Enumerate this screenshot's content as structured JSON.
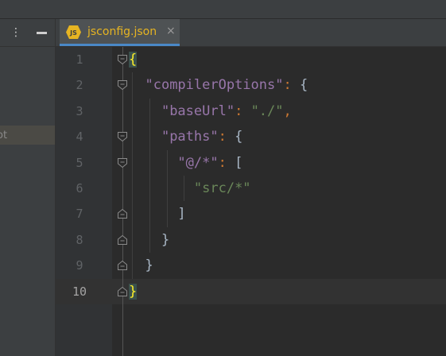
{
  "left_panel": {
    "tree_item_label": "ot"
  },
  "tabs": [
    {
      "label": "jsconfig.json",
      "icon": "js-file-icon",
      "icon_text": "JS",
      "close": "×"
    }
  ],
  "editor": {
    "line_numbers": [
      "1",
      "2",
      "3",
      "4",
      "5",
      "6",
      "7",
      "8",
      "9",
      "10"
    ],
    "current_line": "10",
    "lines": [
      {
        "indent": "",
        "tokens": [
          {
            "t": "{",
            "c": "brace-hl"
          }
        ]
      },
      {
        "indent": "  ",
        "tokens": [
          {
            "t": "\"compilerOptions\"",
            "c": "k"
          },
          {
            "t": ": ",
            "c": "p"
          },
          {
            "t": "{",
            "c": "d"
          }
        ]
      },
      {
        "indent": "    ",
        "tokens": [
          {
            "t": "\"baseUrl\"",
            "c": "k"
          },
          {
            "t": ": ",
            "c": "p"
          },
          {
            "t": "\"./\"",
            "c": "s"
          },
          {
            "t": ",",
            "c": "p"
          }
        ]
      },
      {
        "indent": "    ",
        "tokens": [
          {
            "t": "\"paths\"",
            "c": "k"
          },
          {
            "t": ": ",
            "c": "p"
          },
          {
            "t": "{",
            "c": "d"
          }
        ]
      },
      {
        "indent": "      ",
        "tokens": [
          {
            "t": "\"@/*\"",
            "c": "k"
          },
          {
            "t": ": ",
            "c": "p"
          },
          {
            "t": "[",
            "c": "d"
          }
        ]
      },
      {
        "indent": "        ",
        "tokens": [
          {
            "t": "\"src/*\"",
            "c": "s"
          }
        ]
      },
      {
        "indent": "      ",
        "tokens": [
          {
            "t": "]",
            "c": "d"
          }
        ]
      },
      {
        "indent": "    ",
        "tokens": [
          {
            "t": "}",
            "c": "d"
          }
        ]
      },
      {
        "indent": "  ",
        "tokens": [
          {
            "t": "}",
            "c": "d"
          }
        ]
      },
      {
        "indent": "",
        "tokens": [
          {
            "t": "}",
            "c": "brace-hl"
          }
        ]
      }
    ]
  },
  "colors": {
    "background": "#2b2b2b",
    "key": "#9876aa",
    "string": "#6a8759",
    "punctuation": "#cc7832",
    "tab_title": "#e6b422",
    "tab_underline": "#4a88c7"
  }
}
